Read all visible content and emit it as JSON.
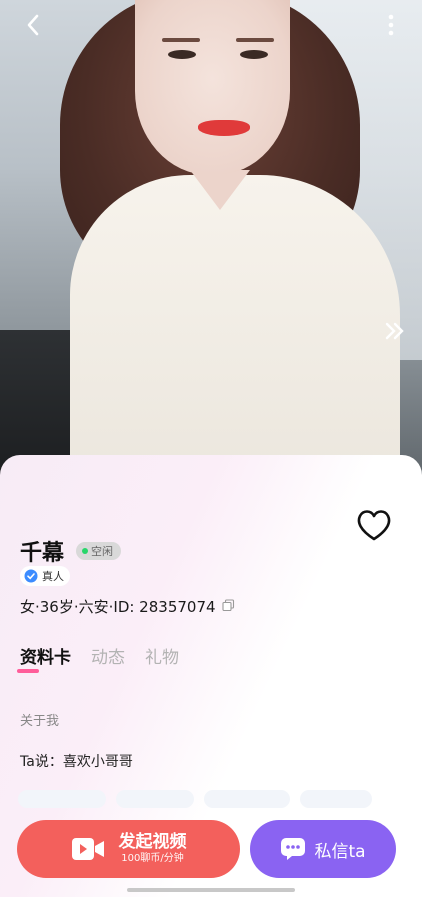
{
  "profile": {
    "name": "千幕",
    "status": "空闲",
    "verified_label": "真人",
    "meta": "女·36岁·六安·ID: 28357074"
  },
  "tabs": [
    {
      "label": "资料卡",
      "active": true
    },
    {
      "label": "动态",
      "active": false
    },
    {
      "label": "礼物",
      "active": false
    }
  ],
  "about": {
    "title": "关于我",
    "bio": "Ta说：喜欢小哥哥"
  },
  "actions": {
    "video_label": "发起视频",
    "video_price": "100聊币/分钟",
    "message_label": "私信ta"
  },
  "icons": {
    "back": "chevron-left-icon",
    "more": "more-vertical-icon",
    "next": "double-chevron-right-icon",
    "favorite": "heart-outline-icon",
    "verified": "verified-badge-icon",
    "copy": "copy-icon",
    "video": "video-camera-icon",
    "chat": "chat-bubble-icon"
  },
  "colors": {
    "video_button": "#f3605c",
    "message_button": "#8a63f2",
    "tab_indicator": "#ff5d9a",
    "status_dot": "#27d66a",
    "verified_blue": "#3c8cff"
  }
}
